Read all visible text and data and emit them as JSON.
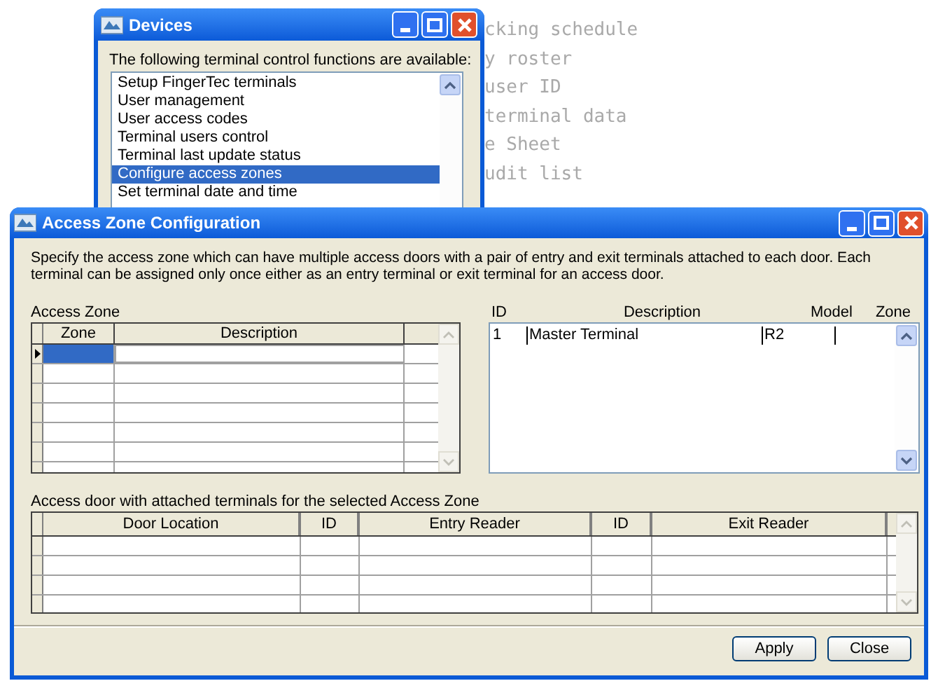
{
  "background_menu": [
    "cking schedule",
    "y roster",
    "user ID",
    "terminal data",
    "e Sheet",
    "udit list"
  ],
  "devices_window": {
    "title": "Devices",
    "prompt": "The following terminal control functions are available:",
    "items": [
      {
        "label": "Setup FingerTec terminals",
        "selected": false
      },
      {
        "label": "User management",
        "selected": false
      },
      {
        "label": "User access codes",
        "selected": false
      },
      {
        "label": "Terminal users control",
        "selected": false
      },
      {
        "label": "Terminal last update status",
        "selected": false
      },
      {
        "label": "Configure access zones",
        "selected": true
      },
      {
        "label": "Set terminal date and time",
        "selected": false
      }
    ]
  },
  "dialog": {
    "title": "Access Zone Configuration",
    "description": "Specify the access zone which can have multiple access doors with a pair of entry and exit terminals attached to each door. Each terminal can be assigned only once either as an entry terminal or exit terminal for an access door.",
    "access_zone": {
      "label": "Access Zone",
      "columns": [
        "Zone",
        "Description"
      ],
      "rows": [
        {
          "selected": true
        },
        {
          "selected": false
        },
        {
          "selected": false
        },
        {
          "selected": false
        },
        {
          "selected": false
        },
        {
          "selected": false
        },
        {
          "selected": false
        }
      ]
    },
    "terminals": {
      "columns": [
        "ID",
        "Description",
        "Model",
        "Zone"
      ],
      "rows": [
        {
          "id": "1",
          "description": "Master Terminal",
          "model": "R2"
        }
      ]
    },
    "doors": {
      "label": "Access door with attached terminals for the selected Access Zone",
      "columns": [
        "Door Location",
        "ID",
        "Entry Reader",
        "ID",
        "Exit Reader"
      ]
    },
    "buttons": [
      "Apply",
      "Close"
    ]
  }
}
